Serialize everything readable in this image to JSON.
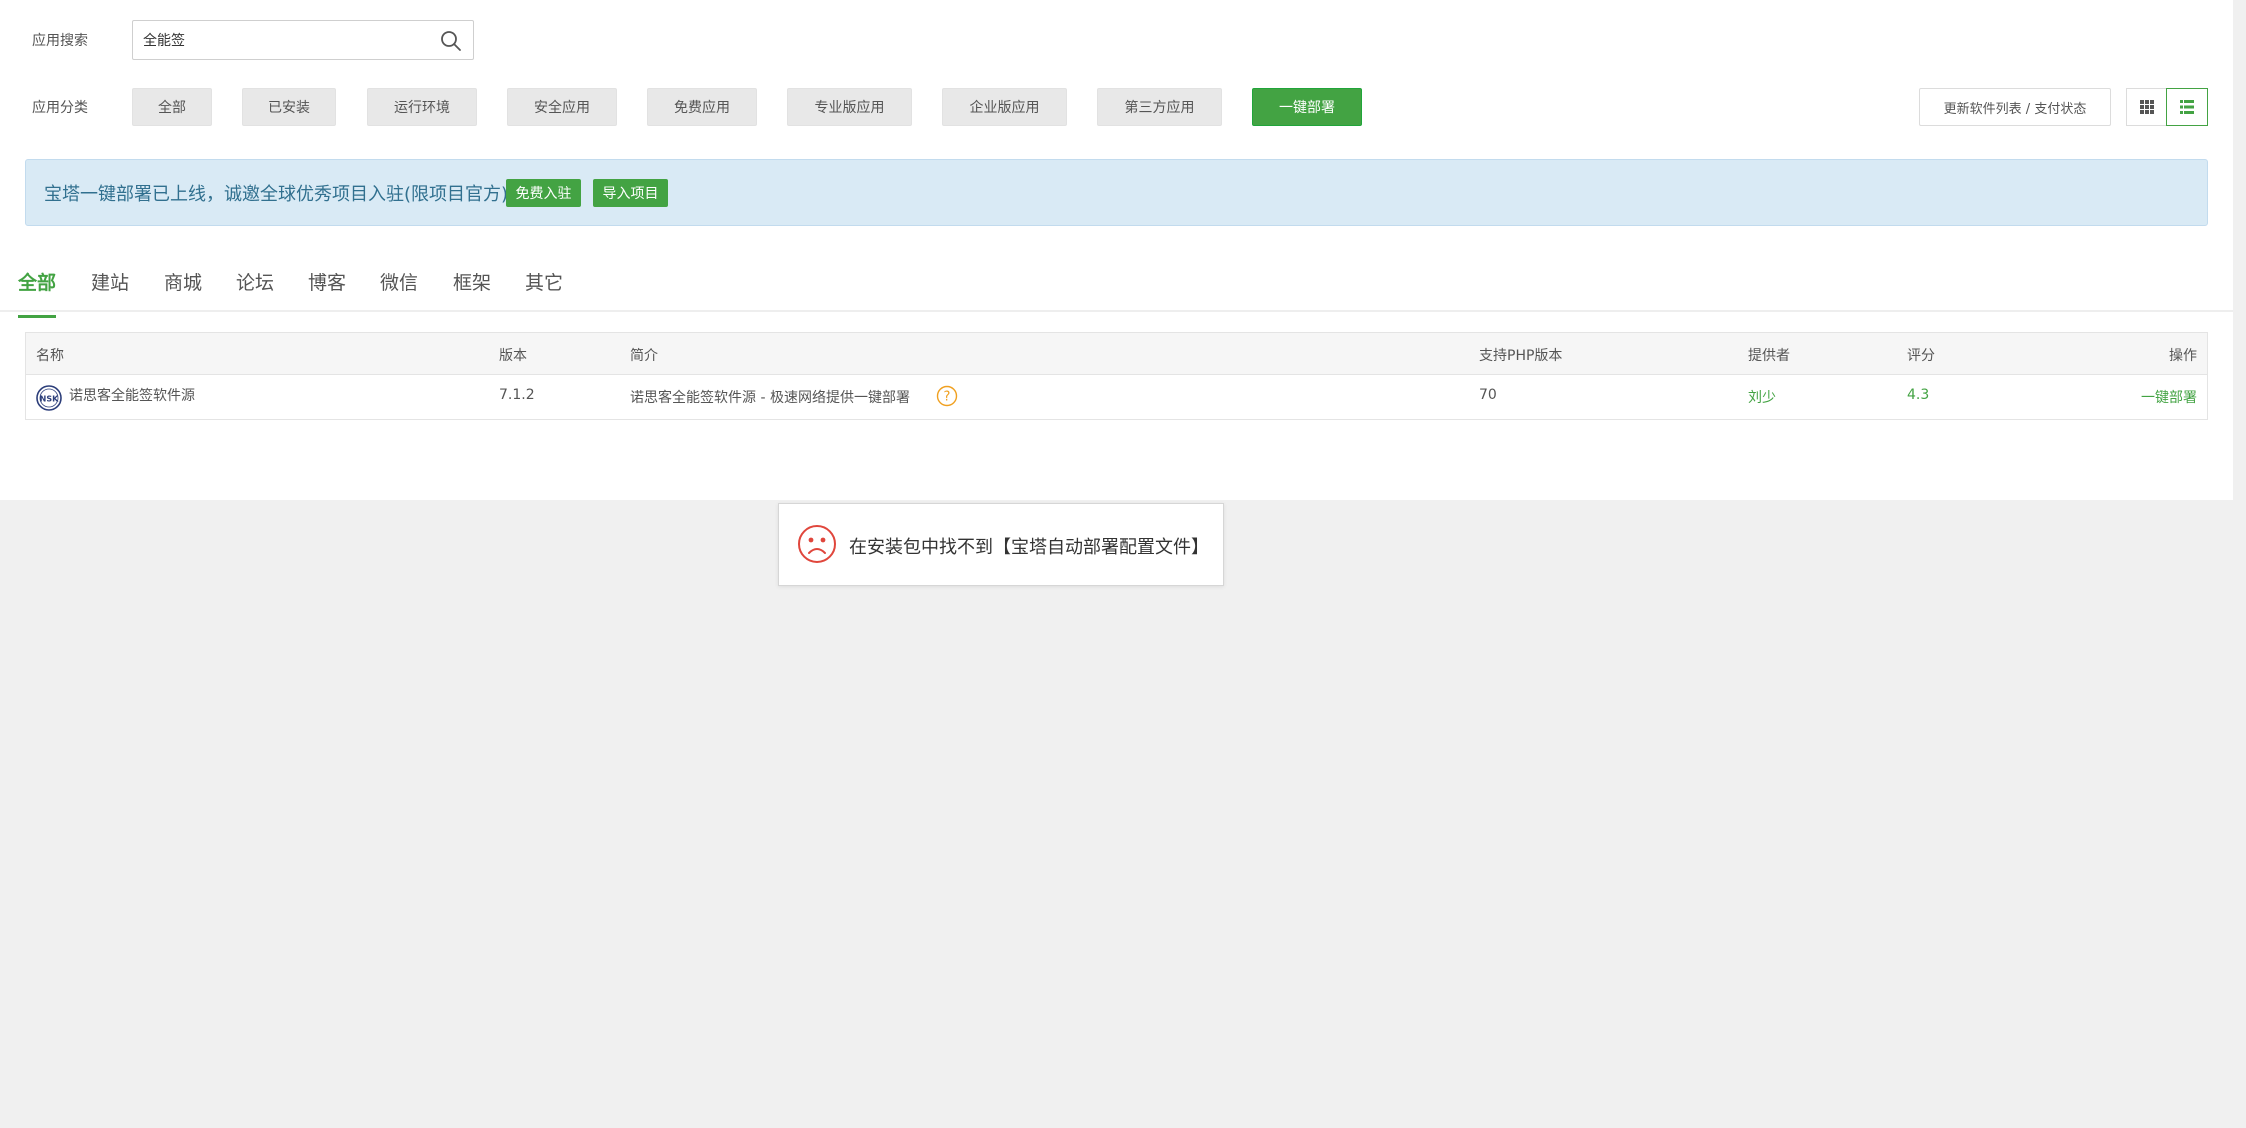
{
  "search": {
    "label": "应用搜索",
    "value": "全能签"
  },
  "categories": {
    "label": "应用分类",
    "items": [
      "全部",
      "已安装",
      "运行环境",
      "安全应用",
      "免费应用",
      "专业版应用",
      "企业版应用",
      "第三方应用",
      "一键部署"
    ],
    "active": "一键部署"
  },
  "toolbar": {
    "update_label": "更新软件列表 / 支付状态"
  },
  "notice": {
    "text": "宝塔一键部署已上线，诚邀全球优秀项目入驻(限项目官方)",
    "tag_free": "免费入驻",
    "tag_import": "导入项目"
  },
  "tabs": [
    "全部",
    "建站",
    "商城",
    "论坛",
    "博客",
    "微信",
    "框架",
    "其它"
  ],
  "table": {
    "headers": {
      "name": "名称",
      "version": "版本",
      "desc": "简介",
      "php": "支持PHP版本",
      "provider": "提供者",
      "score": "评分",
      "action": "操作"
    },
    "rows": [
      {
        "logo": "NSK",
        "name": "诺思客全能签软件源",
        "version": "7.1.2",
        "desc": "诺思客全能签软件源 - 极速网络提供一键部署",
        "php": "70",
        "provider": "刘少",
        "score": "4.3",
        "action": "一键部署"
      }
    ]
  },
  "toast": {
    "text": "在安装包中找不到【宝塔自动部署配置文件】"
  },
  "colors": {
    "accent": "#43a343",
    "notice_bg": "#d9eaf5",
    "notice_text": "#31708f",
    "error": "#e0463c",
    "help": "#f0a020"
  }
}
